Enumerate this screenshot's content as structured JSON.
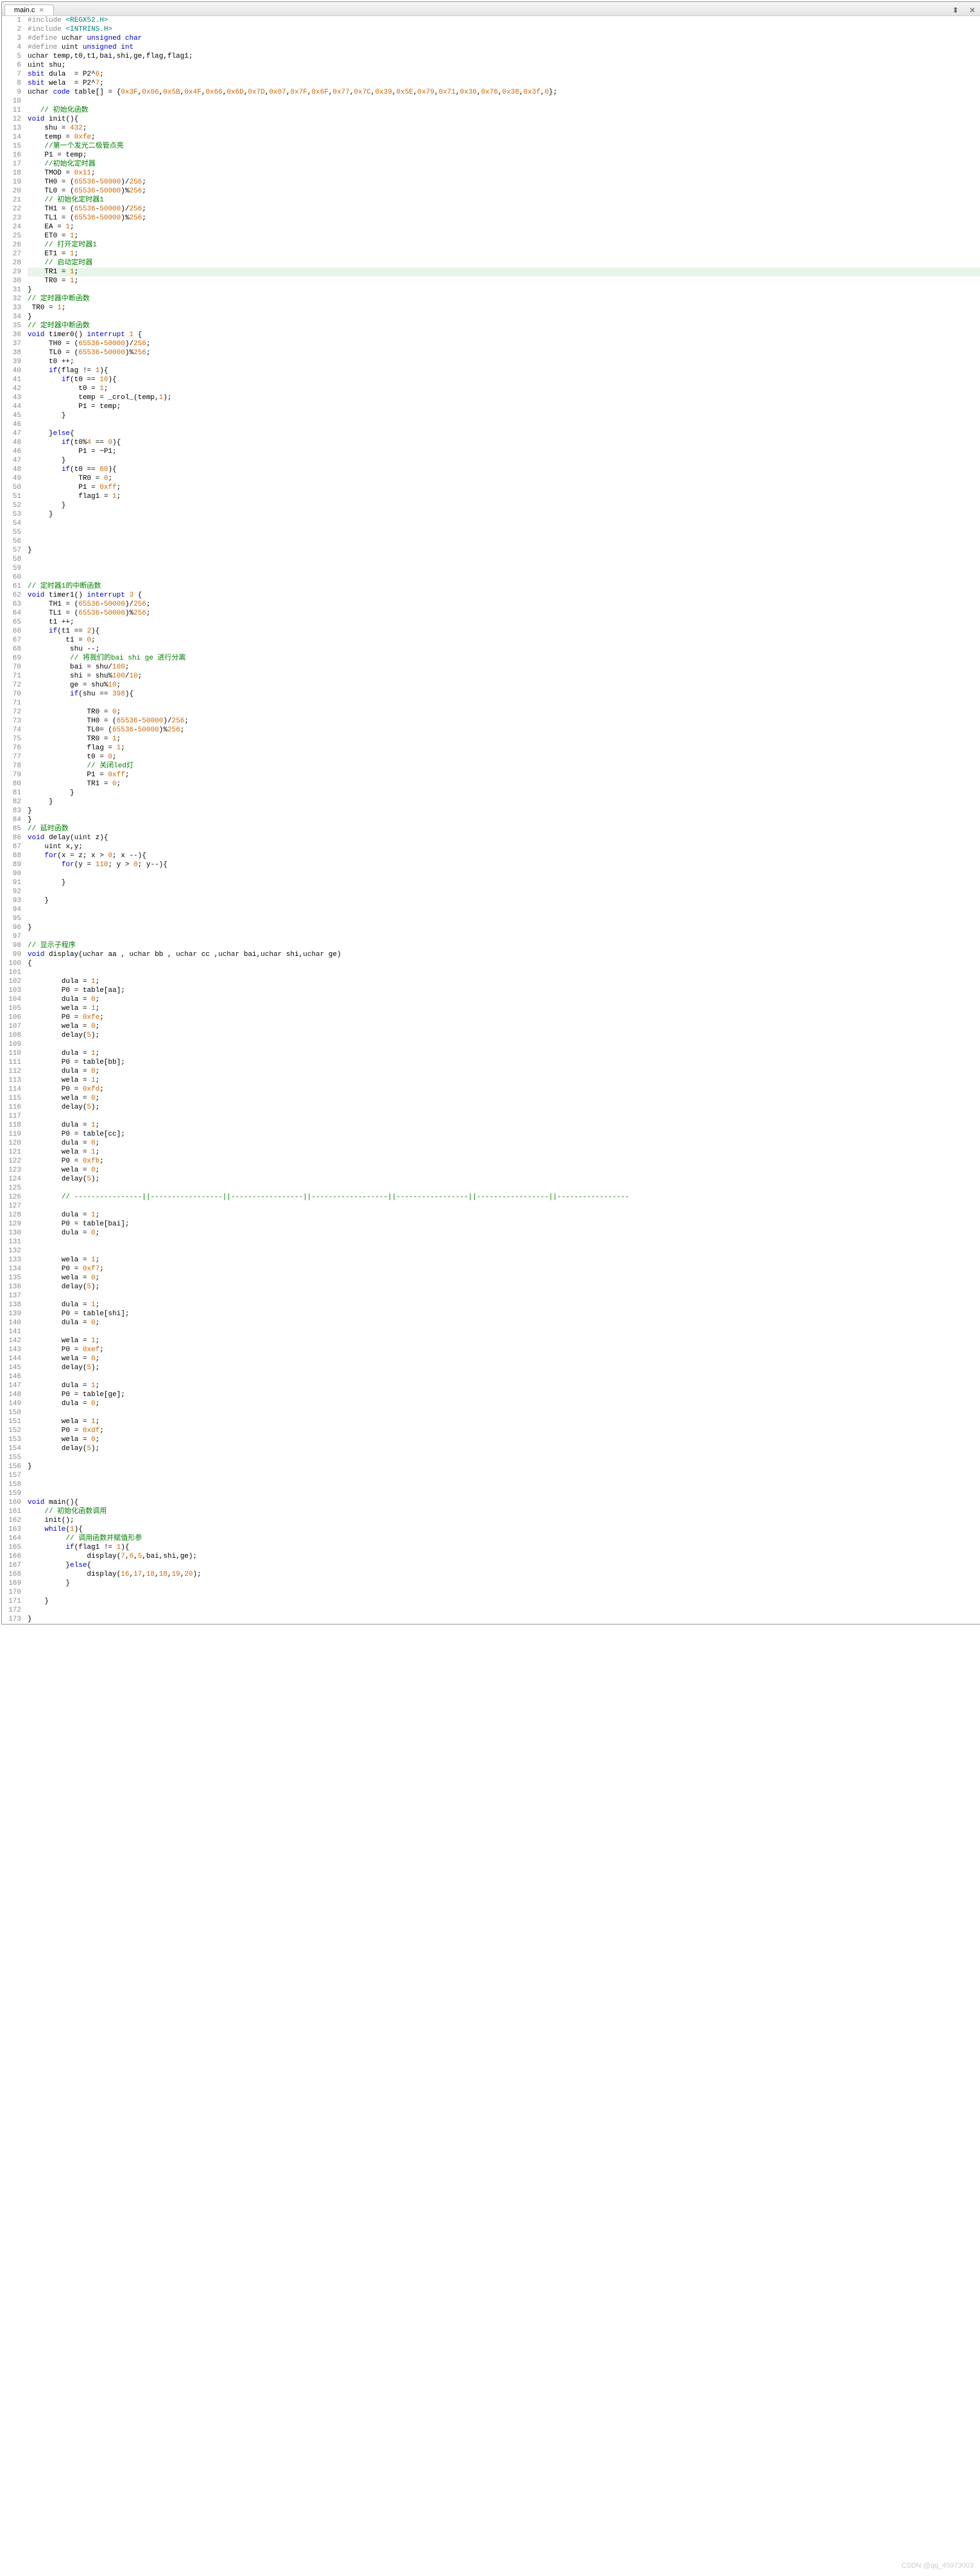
{
  "tab": {
    "title": "main.c",
    "close": "✕"
  },
  "window": {
    "expand": "⬍",
    "close": "✕"
  },
  "watermark": "CSDN @qq_45973003",
  "lines": [
    {
      "n": 1,
      "h": "<span class='pp'>#include</span> <span class='inc'>&lt;REGX52.H&gt;</span>"
    },
    {
      "n": 2,
      "h": "<span class='pp'>#include</span> <span class='inc'>&lt;INTRINS.H&gt;</span>"
    },
    {
      "n": 3,
      "h": "<span class='pp'>#define</span> <span class='id'>uchar</span> <span class='kw'>unsigned</span> <span class='kw'>char</span>"
    },
    {
      "n": 4,
      "h": "<span class='pp'>#define</span> <span class='id'>uint</span> <span class='kw'>unsigned</span> <span class='kw'>int</span>"
    },
    {
      "n": 5,
      "h": "<span class='id'>uchar</span> temp,t0,t1,bai,shi,ge,flag,flag1;"
    },
    {
      "n": 6,
      "h": "<span class='id'>uint</span> shu;"
    },
    {
      "n": 7,
      "h": "<span class='kw'>sbit</span> dula  = P2^<span class='num'>6</span>;"
    },
    {
      "n": 8,
      "h": "<span class='kw'>sbit</span> wela  = P2^<span class='num'>7</span>;"
    },
    {
      "n": 9,
      "h": "<span class='id'>uchar</span> <span class='kw'>code</span> table[] = {<span class='hexv'>0x3F</span>,<span class='hexv'>0x06</span>,<span class='hexv'>0x5B</span>,<span class='hexv'>0x4F</span>,<span class='hexv'>0x66</span>,<span class='hexv'>0x6D</span>,<span class='hexv'>0x7D</span>,<span class='hexv'>0x07</span>,<span class='hexv'>0x7F</span>,<span class='hexv'>0x6F</span>,<span class='hexv'>0x77</span>,<span class='hexv'>0x7C</span>,<span class='hexv'>0x39</span>,<span class='hexv'>0x5E</span>,<span class='hexv'>0x79</span>,<span class='hexv'>0x71</span>,<span class='hexv'>0x36</span>,<span class='hexv'>0x76</span>,<span class='hexv'>0x38</span>,<span class='hexv'>0x3f</span>,<span class='num'>0</span>};"
    },
    {
      "n": 10,
      "h": ""
    },
    {
      "n": 11,
      "h": "   <span class='cm'>// 初始化函数</span>"
    },
    {
      "n": 12,
      "h": "<span class='kw'>void</span> init(){",
      "fold": true
    },
    {
      "n": 13,
      "h": "    shu = <span class='num'>432</span>;"
    },
    {
      "n": 14,
      "h": "    temp = <span class='hexv'>0xfe</span>;"
    },
    {
      "n": 15,
      "h": "    <span class='cm'>//第一个发光二极管点亮</span>"
    },
    {
      "n": 16,
      "h": "    P1 = temp;"
    },
    {
      "n": 17,
      "h": "    <span class='cm'>//初始化定时器</span>"
    },
    {
      "n": 18,
      "h": "    TMOD = <span class='hexv'>0x11</span>;"
    },
    {
      "n": 19,
      "h": "    TH0 = (<span class='num'>65536</span>-<span class='num'>50000</span>)/<span class='num'>256</span>;"
    },
    {
      "n": 20,
      "h": "    TL0 = (<span class='num'>65536</span>-<span class='num'>50000</span>)%<span class='num'>256</span>;"
    },
    {
      "n": 21,
      "h": "    <span class='cm'>// 初始化定时器1</span>"
    },
    {
      "n": 22,
      "h": "    TH1 = (<span class='num'>65536</span>-<span class='num'>50000</span>)/<span class='num'>256</span>;"
    },
    {
      "n": 23,
      "h": "    TL1 = (<span class='num'>65536</span>-<span class='num'>50000</span>)%<span class='num'>256</span>;"
    },
    {
      "n": 24,
      "h": "    EA = <span class='num'>1</span>;"
    },
    {
      "n": 25,
      "h": "    ET0 = <span class='num'>1</span>;"
    },
    {
      "n": 26,
      "h": "    <span class='cm'>// 打开定时器1</span>"
    },
    {
      "n": 27,
      "h": "    ET1 = <span class='num'>1</span>;"
    },
    {
      "n": 28,
      "h": "    <span class='cm'>// 启动定时器</span>"
    },
    {
      "n": 29,
      "h": "    TR1 = <span class='num'>1</span>;",
      "hl": true
    },
    {
      "n": 30,
      "h": "    TR0 = <span class='num'>1</span>;"
    },
    {
      "n": 31,
      "h": "}"
    },
    {
      "n": 32,
      "h": "<span class='cm'>// 定时器中断函数</span>"
    },
    {
      "n": 33,
      "h": " TR0 = <span class='num'>1</span>;",
      "fold": true
    },
    {
      "n": 34,
      "h": "}"
    },
    {
      "n": 35,
      "h": "<span class='cm'>// 定时器中断函数</span>"
    },
    {
      "n": 36,
      "h": "<span class='kw'>void</span> timer0() <span class='kw'>interrupt</span> <span class='num'>1</span> {"
    },
    {
      "n": 37,
      "h": "     TH0 = (<span class='num'>65536</span>-<span class='num'>50000</span>)/<span class='num'>256</span>;",
      "fold": true
    },
    {
      "n": 38,
      "h": "     TL0 = (<span class='num'>65536</span>-<span class='num'>50000</span>)%<span class='num'>256</span>;",
      "fold": true
    },
    {
      "n": 39,
      "h": "     t0 ++;"
    },
    {
      "n": 40,
      "h": "     <span class='kw'>if</span>(flag != <span class='num'>1</span>){"
    },
    {
      "n": 41,
      "h": "        <span class='kw'>if</span>(t0 == <span class='num'>10</span>){"
    },
    {
      "n": 42,
      "h": "            t0 = <span class='num'>1</span>;"
    },
    {
      "n": 43,
      "h": "            temp = _crol_(temp,<span class='num'>1</span>);"
    },
    {
      "n": 44,
      "h": "            P1 = temp;"
    },
    {
      "n": 45,
      "h": "        }"
    },
    {
      "n": 46,
      "h": ""
    },
    {
      "n": 47,
      "h": "     }<span class='kw'>else</span>{"
    },
    {
      "n": 48,
      "h": "        <span class='kw'>if</span>(t0%<span class='num'>4</span> == <span class='num'>0</span>){",
      "fold": true
    },
    {
      "n": 46,
      "h": "            P1 = ~P1;"
    },
    {
      "n": 47,
      "h": "        }"
    },
    {
      "n": 48,
      "h": "        <span class='kw'>if</span>(t0 == <span class='num'>60</span>){",
      "fold": true
    },
    {
      "n": 49,
      "h": "            TR0 = <span class='num'>0</span>;"
    },
    {
      "n": 50,
      "h": "            P1 = <span class='hexv'>0xff</span>;"
    },
    {
      "n": 51,
      "h": "            flag1 = <span class='num'>1</span>;"
    },
    {
      "n": 52,
      "h": "        }"
    },
    {
      "n": 53,
      "h": "     }"
    },
    {
      "n": 54,
      "h": ""
    },
    {
      "n": 55,
      "h": ""
    },
    {
      "n": 56,
      "h": ""
    },
    {
      "n": 57,
      "h": "}"
    },
    {
      "n": 58,
      "h": ""
    },
    {
      "n": 59,
      "h": ""
    },
    {
      "n": 60,
      "h": ""
    },
    {
      "n": 61,
      "h": "<span class='cm'>// 定时器1的中断函数</span>"
    },
    {
      "n": 62,
      "h": "<span class='kw'>void</span> timer1() <span class='kw'>interrupt</span> <span class='num'>3</span> {"
    },
    {
      "n": 63,
      "h": "     TH1 = (<span class='num'>65536</span>-<span class='num'>50000</span>)/<span class='num'>256</span>;",
      "fold": true
    },
    {
      "n": 64,
      "h": "     TL1 = (<span class='num'>65536</span>-<span class='num'>50000</span>)%<span class='num'>256</span>;"
    },
    {
      "n": 65,
      "h": "     t1 ++;"
    },
    {
      "n": 66,
      "h": "     <span class='kw'>if</span>(t1 == <span class='num'>2</span>){"
    },
    {
      "n": 67,
      "h": "         t1 = <span class='num'>0</span>;"
    },
    {
      "n": 68,
      "h": "          shu --;"
    },
    {
      "n": 69,
      "h": "          <span class='cm'>// 将我们的bai shi ge 进行分离</span>"
    },
    {
      "n": 70,
      "h": "          bai = shu/<span class='num'>100</span>;",
      "fold": true
    },
    {
      "n": 71,
      "h": "          shi = shu%<span class='num'>100</span>/<span class='num'>10</span>;"
    },
    {
      "n": 72,
      "h": "          ge = shu%<span class='num'>10</span>;"
    },
    {
      "n": 70,
      "h": "          <span class='kw'>if</span>(shu == <span class='num'>398</span>){",
      "fold": true
    },
    {
      "n": 71,
      "h": ""
    },
    {
      "n": 72,
      "h": "              TR0 = <span class='num'>0</span>;"
    },
    {
      "n": 73,
      "h": "              TH0 = (<span class='num'>65536</span>-<span class='num'>50000</span>)/<span class='num'>256</span>;"
    },
    {
      "n": 74,
      "h": "              TL0= (<span class='num'>65536</span>-<span class='num'>50000</span>)%<span class='num'>256</span>;"
    },
    {
      "n": 75,
      "h": "              TR0 = <span class='num'>1</span>;"
    },
    {
      "n": 76,
      "h": "              flag = <span class='num'>1</span>;"
    },
    {
      "n": 77,
      "h": "              t0 = <span class='num'>0</span>;"
    },
    {
      "n": 78,
      "h": "              <span class='cm'>// 关闭led灯</span>"
    },
    {
      "n": 79,
      "h": "              P1 = <span class='hexv'>0xff</span>;"
    },
    {
      "n": 80,
      "h": "              TR1 = <span class='num'>0</span>;"
    },
    {
      "n": 81,
      "h": "          }"
    },
    {
      "n": 82,
      "h": "     }"
    },
    {
      "n": 83,
      "h": "}"
    },
    {
      "n": 84,
      "h": "}"
    },
    {
      "n": 85,
      "h": "<span class='cm'>// 延时函数</span>"
    },
    {
      "n": 86,
      "h": "<span class='kw'>void</span> delay(<span class='id'>uint</span> z){",
      "fold": true
    },
    {
      "n": 87,
      "h": "    <span class='id'>uint</span> x,y;"
    },
    {
      "n": 88,
      "h": "    <span class='kw'>for</span>(x = z; x > <span class='num'>0</span>; x --){",
      "fold": true
    },
    {
      "n": 89,
      "h": "        <span class='kw'>for</span>(y = <span class='num'>110</span>; y > <span class='num'>0</span>; y--){",
      "fold": true
    },
    {
      "n": 90,
      "h": ""
    },
    {
      "n": 91,
      "h": "        }"
    },
    {
      "n": 92,
      "h": ""
    },
    {
      "n": 93,
      "h": "    }"
    },
    {
      "n": 94,
      "h": ""
    },
    {
      "n": 95,
      "h": ""
    },
    {
      "n": 96,
      "h": "}"
    },
    {
      "n": 97,
      "h": ""
    },
    {
      "n": 98,
      "h": "<span class='cm'>// 显示子程序</span>"
    },
    {
      "n": 99,
      "h": "<span class='kw'>void</span> display(<span class='id'>uchar</span> aa , <span class='id'>uchar</span> bb , <span class='id'>uchar</span> cc ,<span class='id'>uchar</span> bai,<span class='id'>uchar</span> shi,<span class='id'>uchar</span> ge)"
    },
    {
      "n": 100,
      "h": "{",
      "fold": true
    },
    {
      "n": 101,
      "h": ""
    },
    {
      "n": 102,
      "h": "        dula = <span class='num'>1</span>;"
    },
    {
      "n": 103,
      "h": "        P0 = table[aa];"
    },
    {
      "n": 104,
      "h": "        dula = <span class='num'>0</span>;"
    },
    {
      "n": 105,
      "h": "        wela = <span class='num'>1</span>;"
    },
    {
      "n": 106,
      "h": "        P0 = <span class='hexv'>0xfe</span>;"
    },
    {
      "n": 107,
      "h": "        wela = <span class='num'>0</span>;"
    },
    {
      "n": 108,
      "h": "        delay(<span class='num'>5</span>);"
    },
    {
      "n": 109,
      "h": ""
    },
    {
      "n": 110,
      "h": "        dula = <span class='num'>1</span>;"
    },
    {
      "n": 111,
      "h": "        P0 = table[bb];"
    },
    {
      "n": 112,
      "h": "        dula = <span class='num'>0</span>;"
    },
    {
      "n": 113,
      "h": "        wela = <span class='num'>1</span>;"
    },
    {
      "n": 114,
      "h": "        P0 = <span class='hexv'>0xfd</span>;"
    },
    {
      "n": 115,
      "h": "        wela = <span class='num'>0</span>;"
    },
    {
      "n": 116,
      "h": "        delay(<span class='num'>5</span>);"
    },
    {
      "n": 117,
      "h": ""
    },
    {
      "n": 118,
      "h": "        dula = <span class='num'>1</span>;"
    },
    {
      "n": 119,
      "h": "        P0 = table[cc];"
    },
    {
      "n": 120,
      "h": "        dula = <span class='num'>0</span>;"
    },
    {
      "n": 121,
      "h": "        wela = <span class='num'>1</span>;"
    },
    {
      "n": 122,
      "h": "        P0 = <span class='hexv'>0xfb</span>;"
    },
    {
      "n": 123,
      "h": "        wela = <span class='num'>0</span>;"
    },
    {
      "n": 124,
      "h": "        delay(<span class='num'>5</span>);"
    },
    {
      "n": 125,
      "h": ""
    },
    {
      "n": 126,
      "h": "        <span class='cm'>// ----------------||-----------------||-----------------||------------------||-----------------||-----------------||-----------------</span>"
    },
    {
      "n": 127,
      "h": ""
    },
    {
      "n": 128,
      "h": "        dula = <span class='num'>1</span>;"
    },
    {
      "n": 129,
      "h": "        P0 = table[bai];"
    },
    {
      "n": 130,
      "h": "        dula = <span class='num'>0</span>;"
    },
    {
      "n": 131,
      "h": ""
    },
    {
      "n": 132,
      "h": ""
    },
    {
      "n": 133,
      "h": "        wela = <span class='num'>1</span>;"
    },
    {
      "n": 134,
      "h": "        P0 = <span class='hexv'>0xf7</span>;"
    },
    {
      "n": 135,
      "h": "        wela = <span class='num'>0</span>;"
    },
    {
      "n": 136,
      "h": "        delay(<span class='num'>5</span>);"
    },
    {
      "n": 137,
      "h": ""
    },
    {
      "n": 138,
      "h": "        dula = <span class='num'>1</span>;"
    },
    {
      "n": 139,
      "h": "        P0 = table[shi];"
    },
    {
      "n": 140,
      "h": "        dula = <span class='num'>0</span>;"
    },
    {
      "n": 141,
      "h": ""
    },
    {
      "n": 142,
      "h": "        wela = <span class='num'>1</span>;"
    },
    {
      "n": 143,
      "h": "        P0 = <span class='hexv'>0xef</span>;"
    },
    {
      "n": 144,
      "h": "        wela = <span class='num'>0</span>;"
    },
    {
      "n": 145,
      "h": "        delay(<span class='num'>5</span>);"
    },
    {
      "n": 146,
      "h": ""
    },
    {
      "n": 147,
      "h": "        dula = <span class='num'>1</span>;"
    },
    {
      "n": 148,
      "h": "        P0 = table[ge];"
    },
    {
      "n": 149,
      "h": "        dula = <span class='num'>0</span>;"
    },
    {
      "n": 150,
      "h": ""
    },
    {
      "n": 151,
      "h": "        wela = <span class='num'>1</span>;"
    },
    {
      "n": 152,
      "h": "        P0 = <span class='hexv'>0xdf</span>;"
    },
    {
      "n": 153,
      "h": "        wela = <span class='num'>0</span>;"
    },
    {
      "n": 154,
      "h": "        delay(<span class='num'>5</span>);"
    },
    {
      "n": 155,
      "h": ""
    },
    {
      "n": 156,
      "h": "}"
    },
    {
      "n": 157,
      "h": ""
    },
    {
      "n": 158,
      "h": ""
    },
    {
      "n": 159,
      "h": ""
    },
    {
      "n": 160,
      "h": "<span class='kw'>void</span> main(){",
      "fold": true
    },
    {
      "n": 161,
      "h": "    <span class='cm'>// 初始化函数调用</span>"
    },
    {
      "n": 162,
      "h": "    init();"
    },
    {
      "n": 163,
      "h": "    <span class='kw'>while</span>(<span class='num'>1</span>){",
      "fold": true
    },
    {
      "n": 164,
      "h": "         <span class='cm'>// 调用函数并赋值形参</span>"
    },
    {
      "n": 165,
      "h": "         <span class='kw'>if</span>(flag1 != <span class='num'>1</span>){",
      "fold": true
    },
    {
      "n": 166,
      "h": "              display(<span class='num'>7</span>,<span class='num'>6</span>,<span class='num'>5</span>,bai,shi,ge);"
    },
    {
      "n": 167,
      "h": "         }<span class='kw'>else</span>{"
    },
    {
      "n": 168,
      "h": "              display(<span class='num'>16</span>,<span class='num'>17</span>,<span class='num'>18</span>,<span class='num'>18</span>,<span class='num'>19</span>,<span class='num'>20</span>);"
    },
    {
      "n": 169,
      "h": "         }"
    },
    {
      "n": 170,
      "h": ""
    },
    {
      "n": 171,
      "h": "    }"
    },
    {
      "n": 172,
      "h": ""
    },
    {
      "n": 173,
      "h": "}"
    }
  ]
}
